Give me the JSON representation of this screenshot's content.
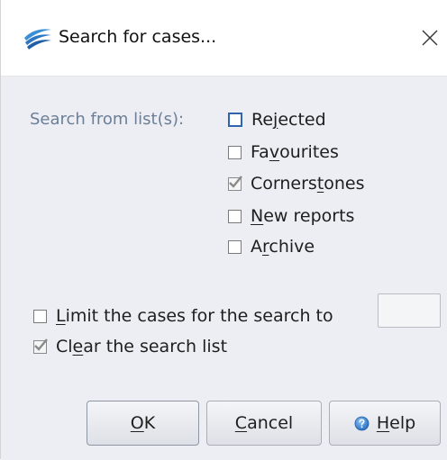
{
  "window": {
    "title": "Search for cases..."
  },
  "icons": {
    "app": "swoosh-logo-icon",
    "close": "close-icon",
    "help": "help-icon"
  },
  "search_lists": {
    "label": "Search from list(s):",
    "items": [
      {
        "before": "Re",
        "mnemonic": "j",
        "after": "ected",
        "checked": false,
        "focused": true
      },
      {
        "before": "Fa",
        "mnemonic": "v",
        "after": "ourites",
        "checked": false,
        "focused": false
      },
      {
        "before": "Corners",
        "mnemonic": "t",
        "after": "ones",
        "checked": true,
        "focused": false
      },
      {
        "before": "",
        "mnemonic": "N",
        "after": "ew reports",
        "checked": false,
        "focused": false
      },
      {
        "before": "A",
        "mnemonic": "r",
        "after": "chive",
        "checked": false,
        "focused": false
      }
    ]
  },
  "limit": {
    "before": "",
    "mnemonic": "L",
    "after": "imit the cases for the search to",
    "checked": false,
    "value": ""
  },
  "clear": {
    "before": "Cl",
    "mnemonic": "e",
    "after": "ar the search list",
    "checked": true
  },
  "buttons": {
    "ok": {
      "before": "",
      "mnemonic": "O",
      "after": "K"
    },
    "cancel": {
      "before": "",
      "mnemonic": "C",
      "after": "ancel"
    },
    "help": {
      "before": "",
      "mnemonic": "H",
      "after": "elp"
    }
  },
  "colors": {
    "accent": "#2f64b0",
    "panel": "#eceef3",
    "label": "#6b7f98"
  }
}
